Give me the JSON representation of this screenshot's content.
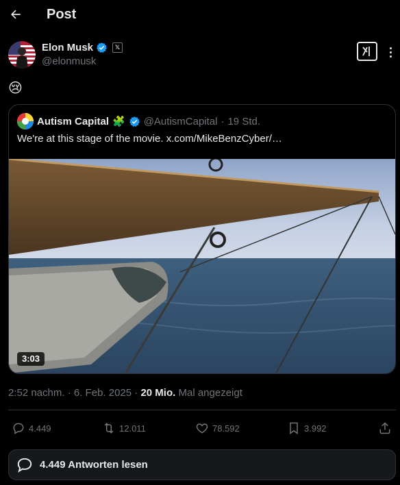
{
  "header": {
    "title": "Post"
  },
  "post": {
    "author_name": "Elon Musk",
    "author_handle": "@elonmusk",
    "x_badge": "𝕏",
    "text": "😢"
  },
  "quote": {
    "author_name": "Autism Capital",
    "author_emoji": "🧩",
    "author_handle": "@AutismCapital",
    "separator": "·",
    "time": "19 Std.",
    "text": "We're at this stage of the movie.  x.com/MikeBenzCyber/…",
    "video_duration": "3:03"
  },
  "meta": {
    "timestamp": "2:52 nachm. · 6. Feb. 2025 ·",
    "views": "20 Mio.",
    "views_label": "Mal angezeigt"
  },
  "actions": {
    "replies": "4.449",
    "reposts": "12.011",
    "likes": "78.592",
    "bookmarks": "3.992"
  },
  "read_replies": {
    "label": "4.449 Antworten lesen"
  },
  "colors": {
    "background": "#000000",
    "text": "#e7e9ea",
    "secondary": "#71767b",
    "border": "#2f3336",
    "verified": "#1d9bf0"
  },
  "icons": [
    "back-arrow-icon",
    "verified-icon",
    "x-logo-icon",
    "grok-icon",
    "more-icon",
    "reply-icon",
    "repost-icon",
    "like-icon",
    "bookmark-icon",
    "share-icon",
    "conversation-icon"
  ]
}
